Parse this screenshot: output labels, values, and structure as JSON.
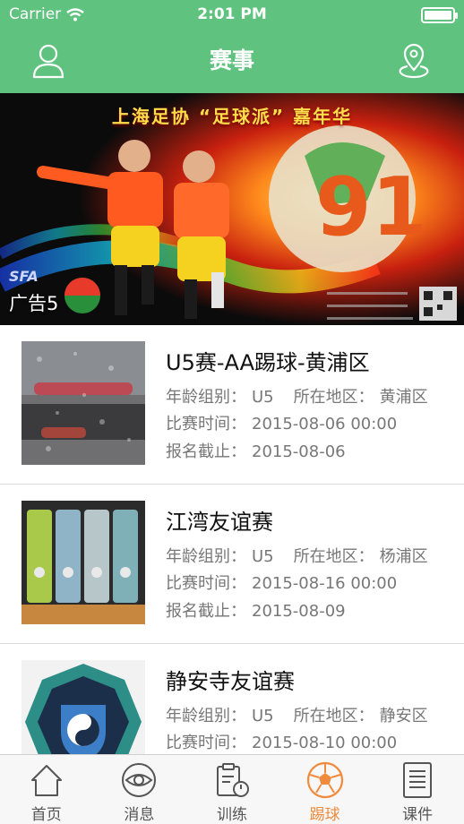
{
  "status_bar": {
    "carrier": "Carrier",
    "time": "2:01 PM"
  },
  "nav": {
    "title": "赛事"
  },
  "banner": {
    "caption": "广告5",
    "headline": "上海足协 “足球派” 嘉年华"
  },
  "labels": {
    "age_group": "年龄组别：",
    "region": "所在地区：",
    "match_time": "比赛时间：",
    "deadline": "报名截止："
  },
  "events": [
    {
      "title": "U5赛-AA踢球-黄浦区",
      "age_group": "U5",
      "region": "黄浦区",
      "match_time": "2015-08-06 00:00",
      "deadline": "2015-08-06"
    },
    {
      "title": "江湾友谊赛",
      "age_group": "U5",
      "region": "杨浦区",
      "match_time": "2015-08-16 00:00",
      "deadline": "2015-08-09"
    },
    {
      "title": "静安寺友谊赛",
      "age_group": "U5",
      "region": "静安区",
      "match_time": "2015-08-10 00:00",
      "deadline": ""
    }
  ],
  "tabs": [
    {
      "label": "首页",
      "icon": "home-icon",
      "active": false
    },
    {
      "label": "消息",
      "icon": "eye-icon",
      "active": false
    },
    {
      "label": "训练",
      "icon": "clipboard-stopwatch-icon",
      "active": false
    },
    {
      "label": "踢球",
      "icon": "soccer-ball-icon",
      "active": true
    },
    {
      "label": "课件",
      "icon": "document-icon",
      "active": false
    }
  ],
  "colors": {
    "brand_green": "#5fc37f",
    "active_orange": "#f08a3c"
  }
}
